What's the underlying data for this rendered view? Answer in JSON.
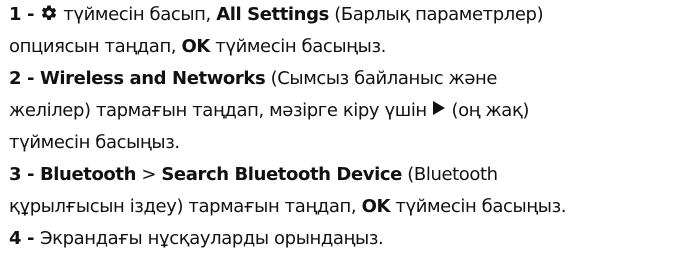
{
  "steps": [
    {
      "number": "1 - ",
      "before_icon": "",
      "icon": "gear-icon",
      "after_icon": " түймесін басып, ",
      "strong1": "All Settings",
      "text1": " (Барлық параметрлер)",
      "line2_text": "опциясын таңдап, ",
      "line2_strong": "OK",
      "line2_end": " түймесін басыңыз."
    },
    {
      "number": "2 - ",
      "strong1": "Wireless and Networks",
      "text1": " (Сымсыз байланыс және",
      "line2_text": "желілер) тармағын таңдап, мәзірге кіру үшін ",
      "icon": "right-arrow-icon",
      "line2_end": " (оң жақ)",
      "line3_text": "түймесін басыңыз."
    },
    {
      "number": "3 - ",
      "strong1": "Bluetooth",
      "sep": " > ",
      "strong2": "Search Bluetooth Device",
      "text1": " (Bluetooth",
      "line2_text": "құрылғысын іздеу) тармағын таңдап, ",
      "line2_strong": "OK",
      "line2_end": " түймесін басыңыз."
    },
    {
      "number": "4 - ",
      "text1": "Экрандағы нұсқауларды орындаңыз."
    }
  ],
  "colors": {
    "text": "#111111",
    "background": "#ffffff"
  }
}
